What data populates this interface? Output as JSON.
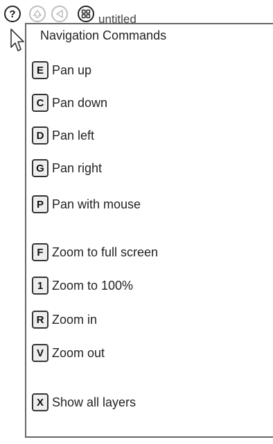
{
  "toolbar": {
    "help_glyph": "?",
    "title": "untitled"
  },
  "menu": {
    "title": "Navigation Commands",
    "items": [
      {
        "key": "E",
        "label": "Pan up"
      },
      {
        "key": "C",
        "label": "Pan down"
      },
      {
        "key": "D",
        "label": "Pan left"
      },
      {
        "key": "G",
        "label": "Pan right"
      },
      {
        "key": "P",
        "label": "Pan with mouse"
      },
      {
        "key": "F",
        "label": "Zoom to full screen"
      },
      {
        "key": "1",
        "label": "Zoom to 100%"
      },
      {
        "key": "R",
        "label": "Zoom in"
      },
      {
        "key": "V",
        "label": "Zoom out"
      },
      {
        "key": "X",
        "label": "Show all layers"
      }
    ]
  },
  "icons": {
    "help": "help-icon",
    "up": "up-arrow-icon",
    "back": "back-arrow-icon",
    "grid": "grid-icon",
    "cursor": "pointer-cursor-icon"
  }
}
